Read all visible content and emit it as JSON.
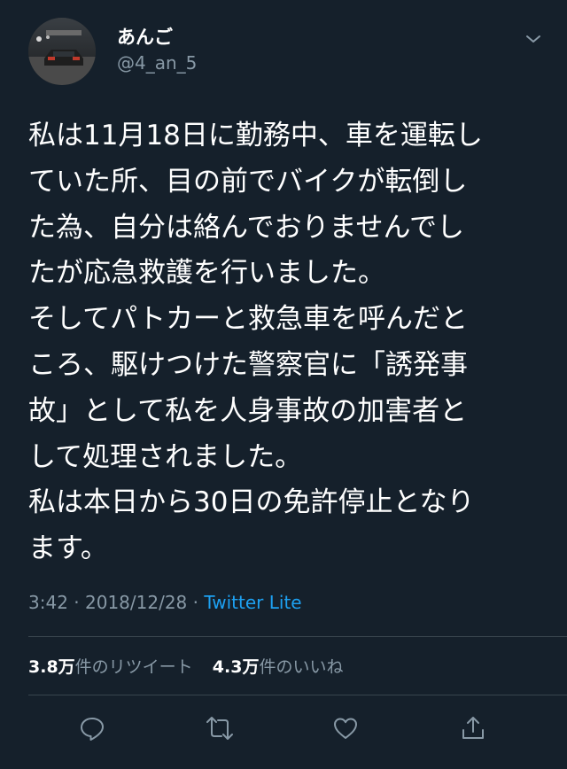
{
  "user": {
    "display_name": "あんご",
    "handle": "@4_an_5"
  },
  "tweet": {
    "text": "私は11月18日に勤務中、車を運転し\nていた所、目の前でバイクが転倒し\nた為、自分は絡んでおりませんでし\nたが応急救護を行いました。\nそしてパトカーと救急車を呼んだと\nころ、駆けつけた警察官に「誘発事\n故」として私を人身事故の加害者と\nして処理されました。\n私は本日から30日の免許停止となり\nます。",
    "time": "3:42",
    "separator": " · ",
    "date": "2018/12/28",
    "source": "Twitter Lite"
  },
  "stats": {
    "retweets_count": "3.8万",
    "retweets_label": "件のリツイート",
    "likes_count": "4.3万",
    "likes_label": "件のいいね"
  },
  "icons": {
    "options": "chevron-down-icon",
    "reply": "reply-icon",
    "retweet": "retweet-icon",
    "like": "heart-icon",
    "share": "share-icon"
  },
  "colors": {
    "background": "#15202b",
    "secondary_text": "#8899a6",
    "link": "#1da1f2",
    "divider": "#38444d"
  }
}
